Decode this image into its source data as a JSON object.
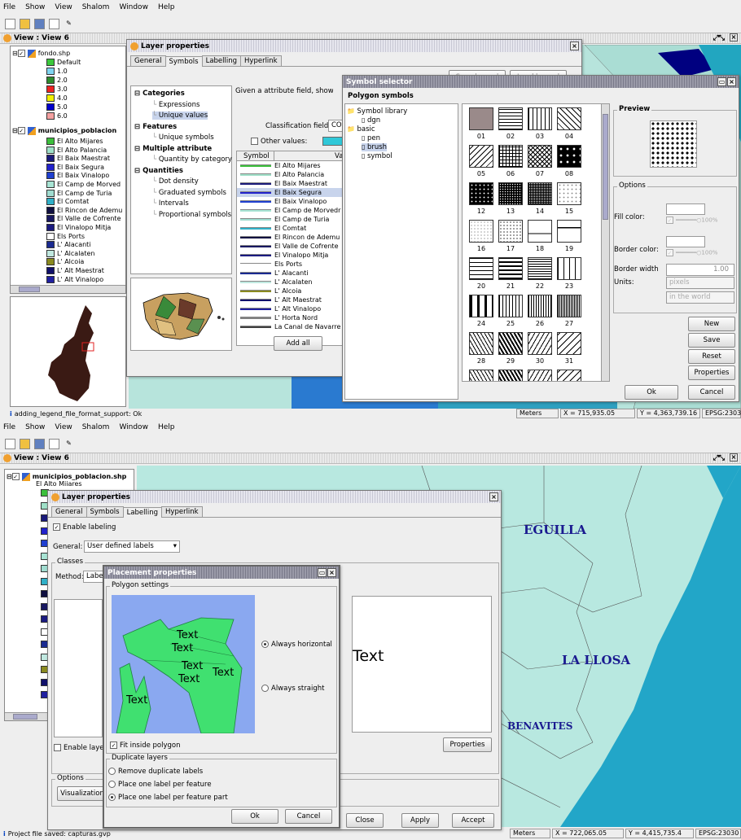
{
  "top": {
    "menu": [
      "File",
      "Show",
      "View",
      "Shalom",
      "Window",
      "Help"
    ],
    "view_title": "View : View 6",
    "toc": {
      "layer1": "fondo.shp",
      "legend1": [
        {
          "label": "Default",
          "color": "#3cc83c"
        },
        {
          "label": "1.0",
          "color": "#7fd4f0"
        },
        {
          "label": "2.0",
          "color": "#2e8b2e"
        },
        {
          "label": "3.0",
          "color": "#ee2222"
        },
        {
          "label": "4.0",
          "color": "#f0f000"
        },
        {
          "label": "5.0",
          "color": "#0000cc"
        },
        {
          "label": "6.0",
          "color": "#f4a0a0"
        }
      ],
      "layer2": "municipios_poblacion",
      "legend2": [
        {
          "label": "El Alto Mijares",
          "color": "#3cbf3c"
        },
        {
          "label": "El Alto Palancia",
          "color": "#9fe0c8"
        },
        {
          "label": "El Baix Maestrat",
          "color": "#1a1a7a"
        },
        {
          "label": "El Baix Segura",
          "color": "#2222cc"
        },
        {
          "label": "El Baix Vinalopo",
          "color": "#2040d0"
        },
        {
          "label": "El Camp de Morved",
          "color": "#a8e4d4"
        },
        {
          "label": "El Camp de Turia",
          "color": "#a0dcd0"
        },
        {
          "label": "El Comtat",
          "color": "#30b0c8"
        },
        {
          "label": "El Rincon de Ademu",
          "color": "#101040"
        },
        {
          "label": "El Valle de Cofrente",
          "color": "#181860"
        },
        {
          "label": "El Vinalopo Mitja",
          "color": "#1a1a80"
        },
        {
          "label": "Els Ports",
          "color": "#ffffff"
        },
        {
          "label": "L' Alacanti",
          "color": "#1a2a90"
        },
        {
          "label": "L' Alcalaten",
          "color": "#c0e8e0"
        },
        {
          "label": "L' Alcoia",
          "color": "#8a8a20"
        },
        {
          "label": "L' Alt Maestrat",
          "color": "#10106a"
        },
        {
          "label": "L' Alt Vinalopo",
          "color": "#2020a0"
        }
      ]
    },
    "layer_props": {
      "title": "Layer properties",
      "tabs": [
        "General",
        "Symbols",
        "Labelling",
        "Hyperlink"
      ],
      "save_legend": "Save legend",
      "load_legend": "Load legend",
      "tree": [
        {
          "t": "Categories",
          "b": true,
          "i": 0
        },
        {
          "t": "Expressions",
          "b": false,
          "i": 1
        },
        {
          "t": "Unique values",
          "b": false,
          "i": 1,
          "sel": true
        },
        {
          "t": "Features",
          "b": true,
          "i": 0
        },
        {
          "t": "Unique symbols",
          "b": false,
          "i": 1
        },
        {
          "t": "Multiple attribute",
          "b": true,
          "i": 0
        },
        {
          "t": "Quantity by category",
          "b": false,
          "i": 1
        },
        {
          "t": "Quantities",
          "b": true,
          "i": 0
        },
        {
          "t": "Dot density",
          "b": false,
          "i": 1
        },
        {
          "t": "Graduated symbols",
          "b": false,
          "i": 1
        },
        {
          "t": "Intervals",
          "b": false,
          "i": 1
        },
        {
          "t": "Proportional symbols",
          "b": false,
          "i": 1
        }
      ],
      "desc": "Given a attribute field, show th",
      "class_field_label": "Classification field:",
      "class_field_value": "COM",
      "other_values": "Other values:",
      "col_symbol": "Symbol",
      "col_value": "Va",
      "rows": [
        {
          "label": "El Alto Mijares",
          "color": "#3cbf3c"
        },
        {
          "label": "El Alto Palancia",
          "color": "#9fe0c8"
        },
        {
          "label": "El Baix Maestrat",
          "color": "#1a1a7a"
        },
        {
          "label": "El Baix Segura",
          "color": "#2222cc",
          "sel": true
        },
        {
          "label": "El Baix Vinalopo",
          "color": "#2040d0"
        },
        {
          "label": "El Camp de Morvedr",
          "color": "#a8e4d4"
        },
        {
          "label": "El Camp de Turia",
          "color": "#a0dcd0"
        },
        {
          "label": "El Comtat",
          "color": "#30b0c8"
        },
        {
          "label": "El Rincon de Ademu",
          "color": "#101040"
        },
        {
          "label": "El Valle de Cofrente",
          "color": "#181860"
        },
        {
          "label": "El Vinalopo Mitja",
          "color": "#1a1a80"
        },
        {
          "label": "Els Ports",
          "color": "#ffffff"
        },
        {
          "label": "L' Alacanti",
          "color": "#1a2a90"
        },
        {
          "label": "L' Alcalaten",
          "color": "#c0e8e0"
        },
        {
          "label": "L' Alcoia",
          "color": "#8a8a20"
        },
        {
          "label": "L' Alt Maestrat",
          "color": "#10106a"
        },
        {
          "label": "L' Alt Vinalopo",
          "color": "#2020a0"
        },
        {
          "label": "L' Horta Nord",
          "color": "#808080"
        },
        {
          "label": "La Canal de Navarre",
          "color": "#404040"
        }
      ],
      "add_all": "Add all"
    },
    "symsel": {
      "title": "Symbol selector",
      "header": "Polygon symbols",
      "tree": [
        {
          "t": "Symbol library",
          "i": 0
        },
        {
          "t": "dgn",
          "i": 1
        },
        {
          "t": "basic",
          "i": 0
        },
        {
          "t": "pen",
          "i": 1
        },
        {
          "t": "brush",
          "i": 1,
          "sel": true
        },
        {
          "t": "symbol",
          "i": 1
        }
      ],
      "labels": [
        "01",
        "02",
        "03",
        "04",
        "05",
        "06",
        "07",
        "08",
        "12",
        "13",
        "14",
        "15",
        "16",
        "17",
        "18",
        "19",
        "20",
        "21",
        "22",
        "23",
        "24",
        "25",
        "26",
        "27",
        "28",
        "29",
        "30",
        "31"
      ],
      "preview": "Preview",
      "options": "Options",
      "fill_color": "Fill color:",
      "border_color": "Border color:",
      "border_width": "Border width",
      "border_width_val": "1.00",
      "units": "Units:",
      "units_val": "pixels",
      "units_val2": "in the world",
      "pct": "100%",
      "buttons": [
        "New",
        "Save",
        "Reset",
        "Properties"
      ],
      "ok": "Ok",
      "cancel": "Cancel"
    },
    "status": {
      "msg": "adding_legend_file_format_support: Ok",
      "units": "Meters",
      "x": "X = 715,935.05",
      "y": "Y = 4,363,739.16",
      "epsg": "EPSG:2303"
    }
  },
  "bottom": {
    "menu": [
      "File",
      "Show",
      "View",
      "Shalom",
      "Window",
      "Help"
    ],
    "view_title": "View : View 6",
    "toc_layer": "municipios_poblacion.shp",
    "toc_first": "El Alto Mijares",
    "toc_colors": [
      "#3cbf3c",
      "#9fe0c8",
      "#1a1a7a",
      "#2222cc",
      "#2040d0",
      "#a8e4d4",
      "#a0dcd0",
      "#30b0c8",
      "#101040",
      "#181860",
      "#1a1a80",
      "#ffffff",
      "#1a2a90",
      "#c0e8e0",
      "#8a8a20",
      "#10106a",
      "#2020a0"
    ],
    "map_labels": [
      "EGUILLA",
      "LA LLOSA",
      "BENAVITES"
    ],
    "layer_props": {
      "title": "Layer properties",
      "tabs": [
        "General",
        "Symbols",
        "Labelling",
        "Hyperlink"
      ],
      "enable_labeling": "Enable labeling",
      "general_label": "General:",
      "general_value": "User defined labels",
      "classes": "Classes",
      "method_label": "Method:",
      "method_value": "Labe",
      "enable_layer": "Enable layer",
      "options": "Options",
      "visualization": "Visualization",
      "preview_text": "Text",
      "properties": "Properties",
      "close": "Close",
      "apply": "Apply",
      "accept": "Accept"
    },
    "placement": {
      "title": "Placement properties",
      "polygon_settings": "Polygon settings",
      "always_horizontal": "Always horizontal",
      "always_straight": "Always straight",
      "fit_inside": "Fit inside polygon",
      "dup_layers": "Duplicate layers",
      "remove_dup": "Remove duplicate labels",
      "one_per_feature": "Place one label per feature",
      "one_per_part": "Place one label per feature part",
      "ok": "Ok",
      "cancel": "Cancel",
      "sample": "Text"
    },
    "status": {
      "msg": "Project file saved: capturas.gvp",
      "units": "Meters",
      "x": "X = 722,065.05",
      "y": "Y = 4,415,735.4",
      "epsg": "EPSG:23030"
    }
  }
}
